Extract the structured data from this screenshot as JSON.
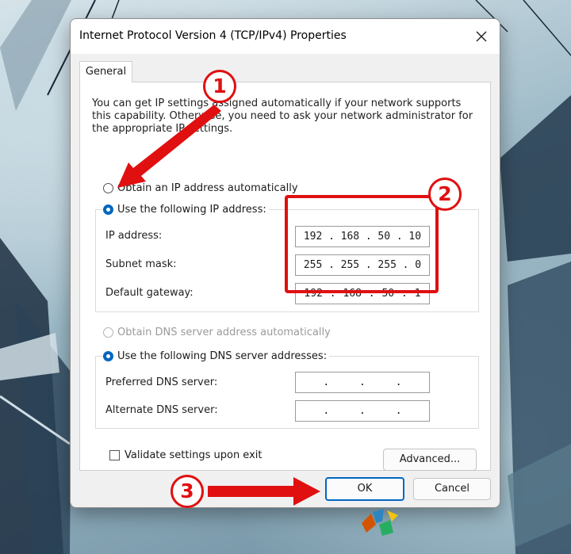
{
  "window": {
    "title": "Internet Protocol Version 4 (TCP/IPv4) Properties"
  },
  "tabs": [
    {
      "label": "General"
    }
  ],
  "intro_text": "You can get IP settings assigned automatically if your network supports this capability. Otherwise, you need to ask your network administrator for the appropriate IP settings.",
  "ip_section": {
    "obtain_auto_label": "Obtain an IP address automatically",
    "use_following_label": "Use the following IP address:",
    "selected": "use_following",
    "fields": [
      {
        "label": "IP address:",
        "octets": [
          "192",
          "168",
          "50",
          "10"
        ]
      },
      {
        "label": "Subnet mask:",
        "octets": [
          "255",
          "255",
          "255",
          "0"
        ]
      },
      {
        "label": "Default gateway:",
        "octets": [
          "192",
          "168",
          "50",
          "1"
        ]
      }
    ]
  },
  "dns_section": {
    "obtain_auto_label": "Obtain DNS server address automatically",
    "use_following_label": "Use the following DNS server addresses:",
    "selected": "use_following",
    "fields": [
      {
        "label": "Preferred DNS server:",
        "octets": [
          "",
          "",
          "",
          ""
        ]
      },
      {
        "label": "Alternate DNS server:",
        "octets": [
          "",
          "",
          "",
          ""
        ]
      }
    ]
  },
  "validate_label": "Validate settings upon exit",
  "validate_checked": false,
  "buttons": {
    "advanced": "Advanced...",
    "ok": "OK",
    "cancel": "Cancel"
  },
  "annotations": {
    "step1": "1",
    "step2": "2",
    "step3": "3",
    "color": "#e01010"
  },
  "colors": {
    "accent": "#0067c0",
    "dialog_bg": "#f0f0f0"
  }
}
